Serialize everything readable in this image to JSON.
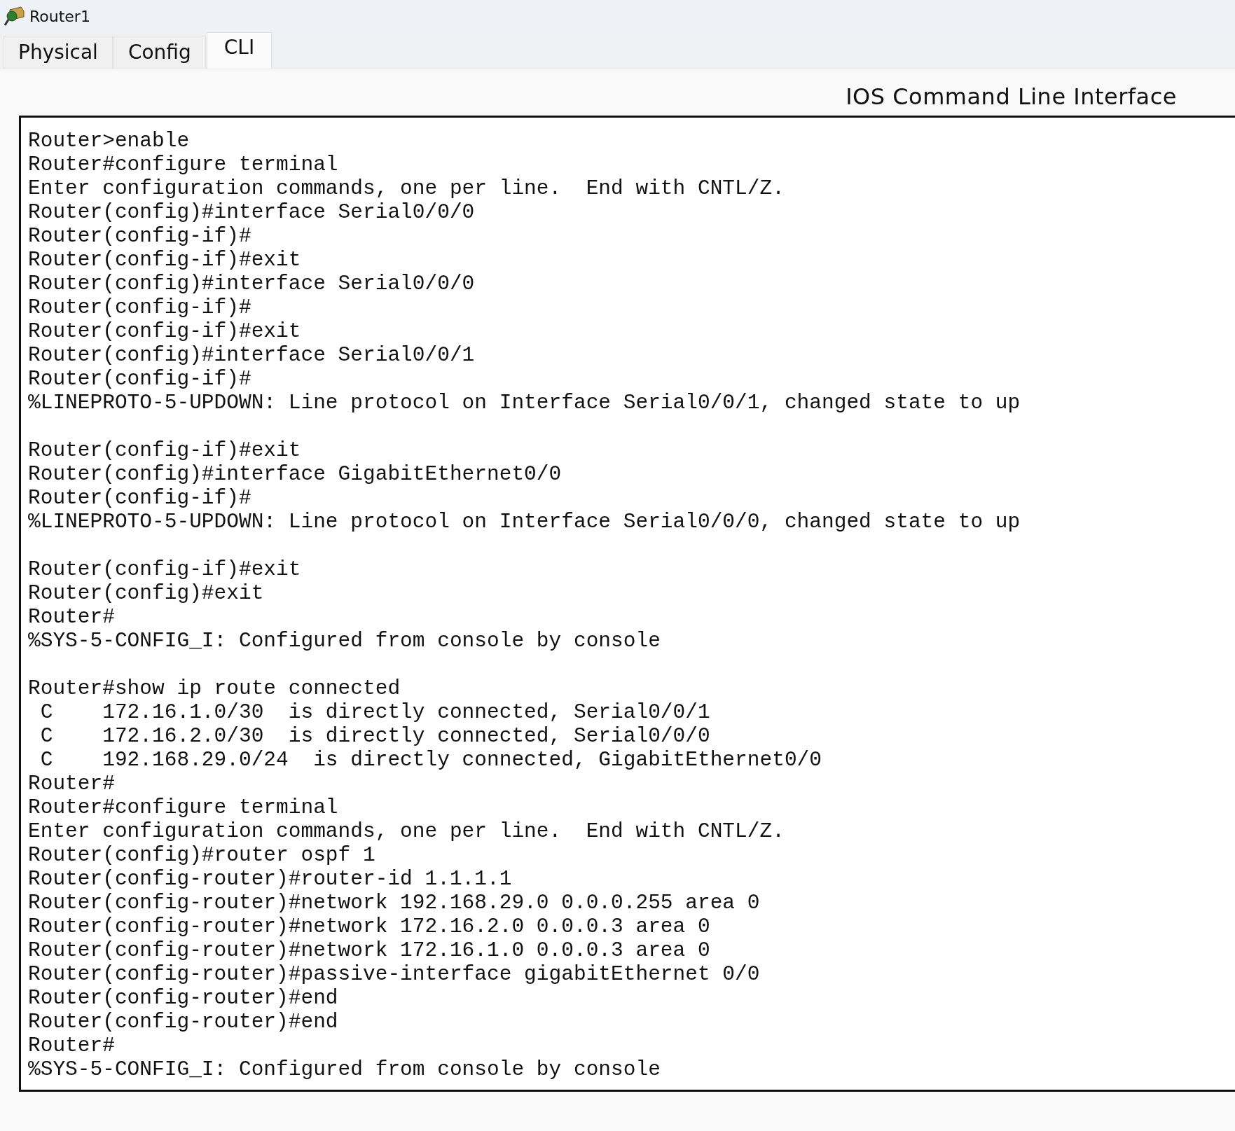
{
  "window": {
    "title": "Router1"
  },
  "tabs": [
    {
      "label": "Physical",
      "selected": false
    },
    {
      "label": "Config",
      "selected": false
    },
    {
      "label": "CLI",
      "selected": true
    }
  ],
  "heading": "IOS Command Line Interface",
  "terminal": {
    "blocks": [
      [
        "Router>enable",
        "Router#configure terminal",
        "Enter configuration commands, one per line.  End with CNTL/Z.",
        "Router(config)#interface Serial0/0/0",
        "Router(config-if)#",
        "Router(config-if)#exit",
        "Router(config)#interface Serial0/0/0",
        "Router(config-if)#",
        "Router(config-if)#exit",
        "Router(config)#interface Serial0/0/1",
        "Router(config-if)#",
        "%LINEPROTO-5-UPDOWN: Line protocol on Interface Serial0/0/1, changed state to up"
      ],
      [
        "Router(config-if)#exit",
        "Router(config)#interface GigabitEthernet0/0",
        "Router(config-if)#",
        "%LINEPROTO-5-UPDOWN: Line protocol on Interface Serial0/0/0, changed state to up"
      ],
      [
        "Router(config-if)#exit",
        "Router(config)#exit",
        "Router#",
        "%SYS-5-CONFIG_I: Configured from console by console"
      ],
      [
        "Router#show ip route connected",
        " C    172.16.1.0/30  is directly connected, Serial0/0/1",
        " C    172.16.2.0/30  is directly connected, Serial0/0/0",
        " C    192.168.29.0/24  is directly connected, GigabitEthernet0/0",
        "Router#",
        "Router#configure terminal",
        "Enter configuration commands, one per line.  End with CNTL/Z.",
        "Router(config)#router ospf 1",
        "Router(config-router)#router-id 1.1.1.1",
        "Router(config-router)#network 192.168.29.0 0.0.0.255 area 0",
        "Router(config-router)#network 172.16.2.0 0.0.0.3 area 0",
        "Router(config-router)#network 172.16.1.0 0.0.0.3 area 0",
        "Router(config-router)#passive-interface gigabitEthernet 0/0",
        "Router(config-router)#end",
        "Router(config-router)#end",
        "Router#",
        "%SYS-5-CONFIG_I: Configured from console by console"
      ]
    ]
  }
}
